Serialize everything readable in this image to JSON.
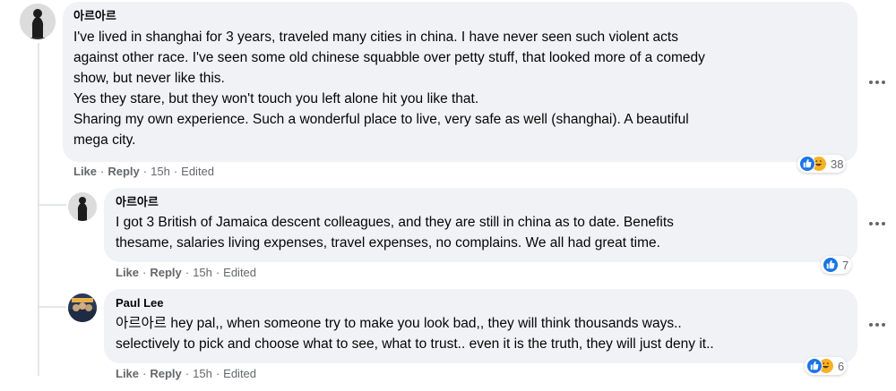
{
  "comments": [
    {
      "author": "아르아르",
      "lines": [
        "I've lived in shanghai for 3 years, traveled many cities in china. I have never seen such violent acts",
        "against other race. I've seen some old chinese squabble over petty stuff, that looked more of a comedy",
        "show, but never like this.",
        "Yes they stare, but they won't touch you left alone hit you like that.",
        "Sharing my own experience. Such a wonderful place to live, very safe as well (shanghai). A beautiful",
        "mega city."
      ],
      "actions": {
        "like": "Like",
        "reply": "Reply",
        "time": "15h",
        "edited": "Edited"
      },
      "reaction_count": "38"
    },
    {
      "author": "아르아르",
      "lines": [
        "I got 3 British of Jamaica descent colleagues, and they are still in china as to date. Benefits",
        "thesame, salaries living expenses, travel expenses, no complains. We all had great time."
      ],
      "actions": {
        "like": "Like",
        "reply": "Reply",
        "time": "15h",
        "edited": "Edited"
      },
      "reaction_count": "7"
    },
    {
      "author": "Paul Lee",
      "lines": [
        "아르아르  hey pal,, when someone try to make you look bad,, they will think thousands ways..",
        "selectively to pick and choose what to see, what to trust.. even it is the truth, they will just deny it.."
      ],
      "actions": {
        "like": "Like",
        "reply": "Reply",
        "time": "15h",
        "edited": "Edited"
      },
      "reaction_count": "6"
    }
  ],
  "colors": {
    "bubble": "#f0f2f5",
    "like_blue": "#1b74e4",
    "haha_yellow": "#f7b125",
    "secondary_text": "#65676b"
  },
  "icons": [
    "more-options-icon",
    "like-reaction-icon",
    "haha-reaction-icon"
  ]
}
